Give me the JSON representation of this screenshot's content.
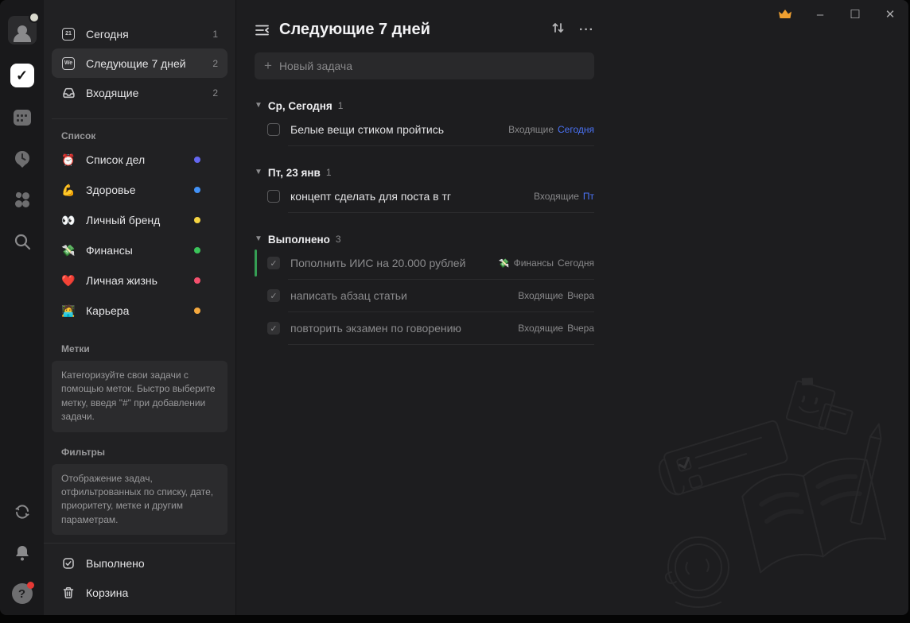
{
  "theme": {
    "accent_blue": "#4a72f5",
    "crown_orange": "#f0a030",
    "finance_green": "#359e54"
  },
  "window_controls": {
    "minimize": "–",
    "maximize": "☐",
    "close": "✕"
  },
  "rail": {
    "help_glyph": "?"
  },
  "sidebar": {
    "nav": [
      {
        "icon_text": "21",
        "label": "Сегодня",
        "count": "1"
      },
      {
        "icon_text": "We",
        "label": "Следующие 7 дней",
        "count": "2"
      },
      {
        "icon_text": "",
        "label": "Входящие",
        "count": "2"
      }
    ],
    "lists_header": "Список",
    "lists": [
      {
        "emoji": "⏰",
        "label": "Список дел",
        "dot": "#6467f0"
      },
      {
        "emoji": "💪",
        "label": "Здоровье",
        "dot": "#4292f7"
      },
      {
        "emoji": "👀",
        "label": "Личный бренд",
        "dot": "#f5d442"
      },
      {
        "emoji": "💸",
        "label": "Финансы",
        "dot": "#3bc45a"
      },
      {
        "emoji": "❤️",
        "label": "Личная жизнь",
        "dot": "#f5506e"
      },
      {
        "emoji": "🧑‍💻",
        "label": "Карьера",
        "dot": "#f5a93e"
      }
    ],
    "tags_header": "Метки",
    "tags_hint": "Категоризуйте свои задачи с помощью меток. Быстро выберите метку, введя \"#\" при добавлении задачи.",
    "filters_header": "Фильтры",
    "filters_hint": "Отображение задач, отфильтрованных по списку, дате, приоритету, метке и другим параметрам.",
    "footer": [
      {
        "label": "Выполнено"
      },
      {
        "label": "Корзина"
      }
    ]
  },
  "main": {
    "title": "Следующие 7 дней",
    "new_task_plus": "+",
    "new_task_placeholder": "Новый задача",
    "more_glyph": "···",
    "groups": [
      {
        "label": "Ср, Сегодня",
        "count": "1",
        "tasks": [
          {
            "title": "Белые вещи стиком пройтись",
            "list": "Входящие",
            "date": "Сегодня"
          }
        ]
      },
      {
        "label": "Пт, 23 янв",
        "count": "1",
        "tasks": [
          {
            "title": "концепт сделать для поста в тг",
            "list": "Входящие",
            "date": "Пт"
          }
        ]
      },
      {
        "label": "Выполнено",
        "count": "3",
        "tasks": [
          {
            "title": "Пополнить ИИС на 20.000 рублей",
            "list_emoji": "💸",
            "list": "Финансы",
            "date": "Сегодня",
            "check": "✓"
          },
          {
            "title": "написать абзац статьи",
            "list": "Входящие",
            "date": "Вчера",
            "check": "✓"
          },
          {
            "title": "повторить экзамен по говорению",
            "list": "Входящие",
            "date": "Вчера",
            "check": "✓"
          }
        ]
      }
    ]
  }
}
